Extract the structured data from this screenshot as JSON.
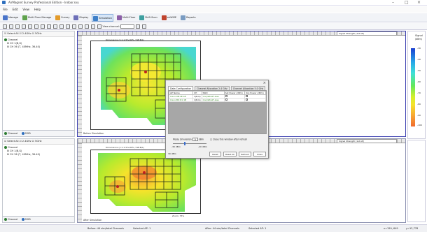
{
  "window": {
    "title": "AirMagnet Survey Professional Edition - Indoor.svy"
  },
  "menu": [
    "File",
    "Edit",
    "View",
    "Help"
  ],
  "toolbar": [
    {
      "label": "Manage",
      "icon": "manage-icon",
      "color": "#4a74c9"
    },
    {
      "label": "Multi Floor Manage",
      "icon": "multi-floor-icon",
      "color": "#5fa24c"
    },
    {
      "label": "Survey",
      "icon": "survey-icon",
      "color": "#e39b2b"
    },
    {
      "label": "Display",
      "icon": "display-icon",
      "color": "#6d6fb8"
    },
    {
      "label": "Simulation",
      "icon": "simulation-icon",
      "color": "#3d7fc8",
      "active": true
    },
    {
      "label": "Multi-Floor",
      "icon": "multi-floor-view-icon",
      "color": "#8c5fa8"
    },
    {
      "label": "Drift Scan",
      "icon": "drift-scan-icon",
      "color": "#3fa0a0"
    },
    {
      "label": "airWISE",
      "icon": "airwise-icon",
      "color": "#c0442e"
    },
    {
      "label": "Reports",
      "icon": "reports-icon",
      "color": "#7a9cc2"
    }
  ],
  "toolbar2": {
    "view_channel_label": "View channel:"
  },
  "top_panel": {
    "select_all": "Select All",
    "band_24": "2.4GHz",
    "band_5": "5GHz",
    "tree_root": "Channel",
    "tree_items": [
      "CH 1(B,G)",
      "CH 36 (T, 40MHz, 36-40)"
    ],
    "footer_channel": "Channel",
    "footer_ssid": "SSID",
    "signal_label": "Signal Strength (1st AP)",
    "scale_text": "Dimensions (1:1:1.5%,80% / NE:B/1)",
    "corner_label": "Before Simulation"
  },
  "bottom_panel": {
    "select_all": "Select All",
    "band_24": "2.4GHz",
    "band_5": "5GHz",
    "tree_root": "Channel",
    "tree_items": [
      "CH 1(B,G)",
      "CH 36 (T, 40MHz, 36-40)"
    ],
    "footer_channel": "Channel",
    "footer_ssid": "SSID",
    "signal_label": "Signal Strength (1st AP)",
    "scale_text": "Dimensions (1:1:1.5%,80% / NE:B/1)",
    "corner_label": "After Simulation",
    "zoom_label": "Zoom: 75%"
  },
  "legend": {
    "title": "Signal",
    "unit": "(dBm)",
    "ticks": [
      "-30",
      "-40",
      "-50",
      "-60",
      "-70",
      "-80",
      "-90",
      "-100"
    ]
  },
  "dialog": {
    "tabs": [
      "Data Configuration",
      "Channel Allocation 2.4 GHz",
      "Channel Allocation 5.0 GHz"
    ],
    "columns": [
      "AP Name",
      "CH",
      "SSID",
      "Set Power (dBm)",
      "Org Power (dBm)"
    ],
    "rows": [
      {
        "name": "Cisco:0B:4E:AE",
        "ch": "1(B,G)",
        "ssid": "CorpWireFi-less"
      },
      {
        "name": "Cisco:B6:D1:1B",
        "ch": "1(B,G)",
        "ssid": "CorpWireFi-less"
      }
    ],
    "mode_label": "Mode Simulation",
    "mode_value": "0",
    "mode_unit": "dBm",
    "close_checkbox": "Close this window after refresh",
    "slider_min": "-30 dBm",
    "slider_mid": "-20 dBm",
    "slider_max": "30 dBm",
    "buttons": [
      "Reset",
      "Reset All",
      "Refresh",
      "Close"
    ]
  },
  "status": {
    "before": "Before: 44 sim/total Channels",
    "selected_a": "Selected AP: 1",
    "after": "After: 44 sim/total Channels",
    "selected_b": "Selected AP: 1",
    "coords": "x=159, 649",
    "zoom": "y=12,778"
  }
}
